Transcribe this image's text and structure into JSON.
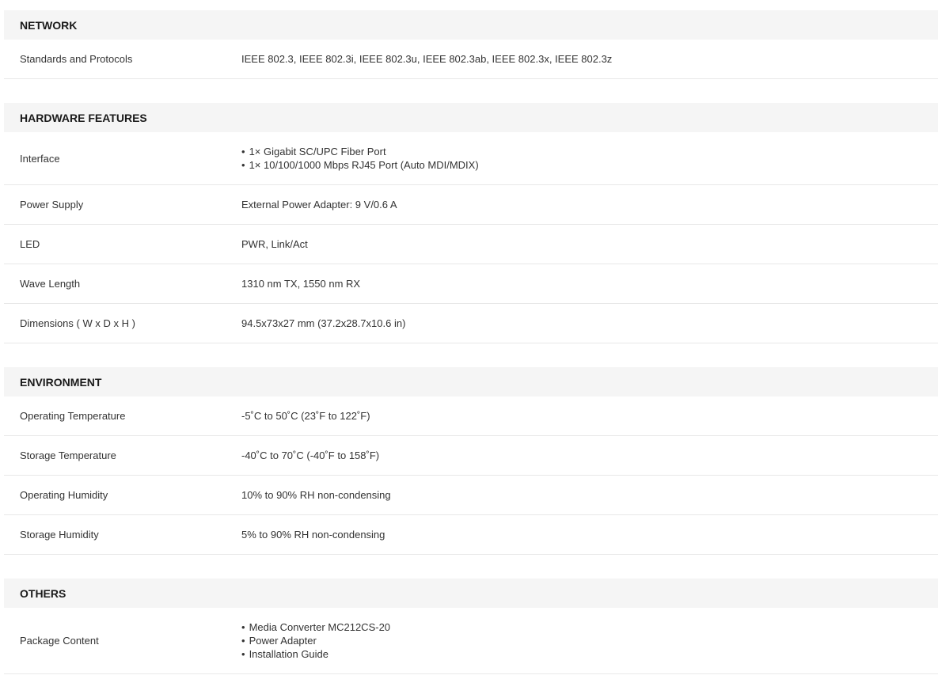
{
  "sections": [
    {
      "title": "NETWORK",
      "rows": [
        {
          "label": "Standards and Protocols",
          "value": "IEEE 802.3, IEEE 802.3i, IEEE 802.3u, IEEE 802.3ab, IEEE 802.3x, IEEE 802.3z"
        }
      ]
    },
    {
      "title": "HARDWARE FEATURES",
      "rows": [
        {
          "label": "Interface",
          "items": [
            "1× Gigabit SC/UPC Fiber Port",
            "1× 10/100/1000 Mbps RJ45 Port (Auto MDI/MDIX)"
          ]
        },
        {
          "label": "Power Supply",
          "value": "External Power Adapter: 9 V/0.6 A"
        },
        {
          "label": "LED",
          "value": "PWR, Link/Act"
        },
        {
          "label": "Wave Length",
          "value": "1310 nm TX, 1550 nm RX"
        },
        {
          "label": "Dimensions ( W x D x H )",
          "value": "94.5x73x27 mm (37.2x28.7x10.6 in)"
        }
      ]
    },
    {
      "title": "ENVIRONMENT",
      "rows": [
        {
          "label": "Operating Temperature",
          "value": "-5˚C to 50˚C (23˚F to 122˚F)"
        },
        {
          "label": "Storage Temperature",
          "value": "-40˚C to 70˚C (-40˚F to 158˚F)"
        },
        {
          "label": "Operating Humidity",
          "value": "10% to 90% RH non-condensing"
        },
        {
          "label": "Storage Humidity",
          "value": "5% to 90% RH non-condensing"
        }
      ]
    },
    {
      "title": "OTHERS",
      "rows": [
        {
          "label": "Package Content",
          "items": [
            "Media Converter MC212CS-20",
            "Power Adapter",
            "Installation Guide"
          ]
        }
      ]
    }
  ]
}
